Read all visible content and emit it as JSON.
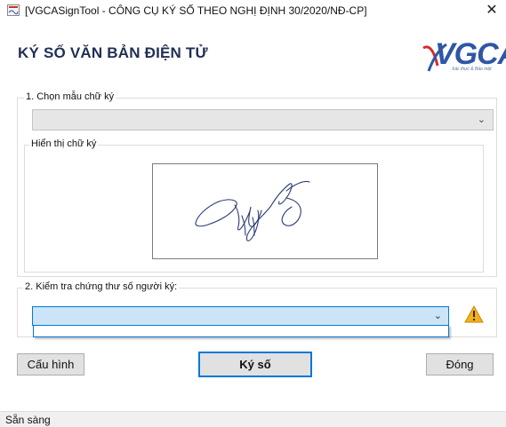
{
  "window": {
    "title": "[VGCASignTool - CÔNG CỤ KÝ SỐ THEO NGHỊ ĐỊNH 30/2020/NĐ-CP]",
    "close_glyph": "✕"
  },
  "header": {
    "heading": "KÝ SỐ VĂN BẢN ĐIỆN TỬ",
    "logo_text": "VGCA",
    "logo_tagline": "Xác thực & Bảo mật"
  },
  "section1": {
    "legend": "1. Chọn mẫu chữ ký",
    "template_select_value": "",
    "preview_legend": "Hiển thị chữ ký"
  },
  "section2": {
    "legend": "2. Kiểm tra chứng thư số người ký:",
    "cert_select_value": "",
    "warning_icon": "warning-icon"
  },
  "buttons": {
    "config": "Cấu hình",
    "sign": "Ký số",
    "close": "Đóng"
  },
  "status": {
    "text": "Sẵn sàng"
  },
  "colors": {
    "accent": "#0078d7",
    "heading": "#1f2f55",
    "logo": "#2f56a6",
    "warning": "#f2b01e"
  }
}
